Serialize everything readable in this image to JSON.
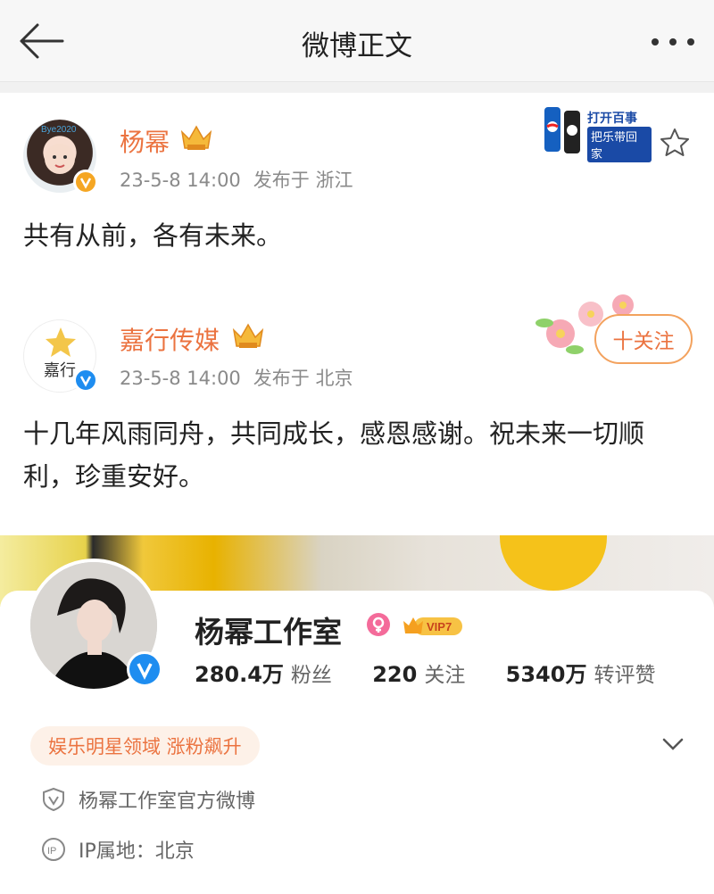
{
  "header": {
    "title": "微博正文"
  },
  "posts": [
    {
      "author": "杨幂",
      "time": "23-5-8 14:00",
      "location": "发布于 浙江",
      "content": "共有从前，各有未来。"
    },
    {
      "author": "嘉行传媒",
      "avatar_text": "嘉行",
      "time": "23-5-8 14:00",
      "location": "发布于 北京",
      "content": "十几年风雨同舟，共同成长，感恩感谢。祝未来一切顺利，珍重安好。",
      "follow_label": "十关注"
    }
  ],
  "promo": {
    "line1": "打开百事",
    "line2": "把乐带回家"
  },
  "profile": {
    "name": "杨幂工作室",
    "vip_label": "VIP7",
    "stats": [
      {
        "value": "280.4万",
        "label": "粉丝"
      },
      {
        "value": "220",
        "label": "关注"
      },
      {
        "value": "5340万",
        "label": "转评赞"
      }
    ],
    "tag": "娱乐明星领域 涨粉飙升",
    "verified": "杨幂工作室官方微博",
    "ip": "IP属地：北京"
  },
  "colors": {
    "accent": "#eb7340",
    "verified_blue": "#1e8df0",
    "verified_orange": "#f5a623"
  }
}
